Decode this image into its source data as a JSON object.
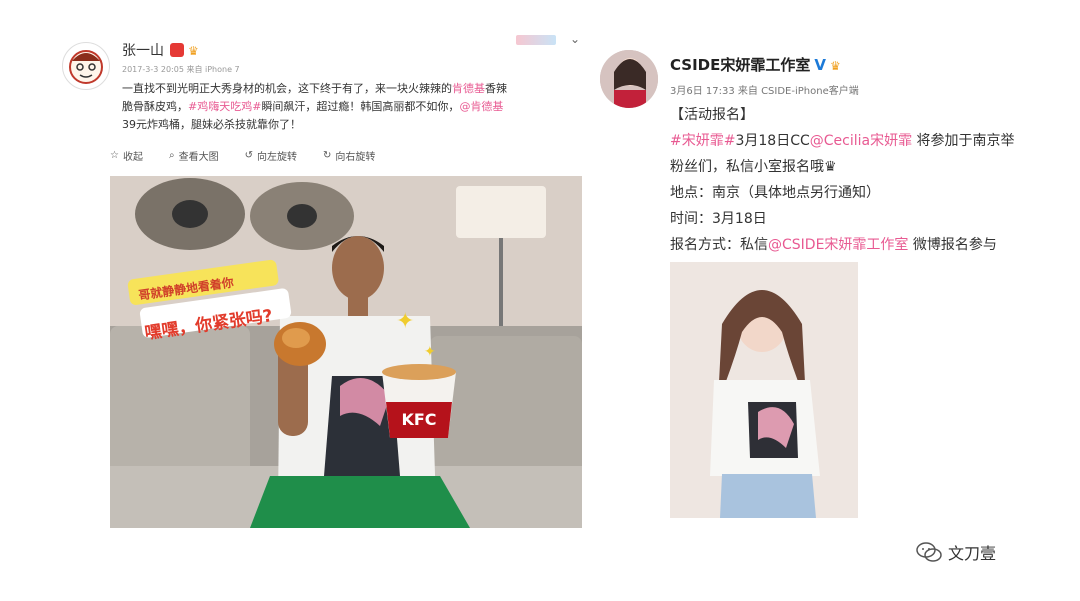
{
  "left_post": {
    "user_name": "张一山",
    "meta": "2017-3-3 20:05 来自 iPhone 7",
    "top_right_label": "⌄",
    "text_lines": [
      [
        "一直找不到光明正大秀身材的机会，这下终于有了，来一块火辣辣的",
        {
          "hl": "肯德基"
        },
        "香辣"
      ],
      [
        "脆骨酥皮鸡，",
        {
          "hl": "#鸡嗨天吃鸡#"
        },
        "瞬间飙汗，超过瘾！韩国高丽都不如你，",
        {
          "hl": "@肯德基"
        }
      ],
      [
        "39元炸鸡桶，腿妹必杀技就靠你了！"
      ]
    ],
    "toolbar": [
      {
        "icon": "star-icon",
        "label": "收起"
      },
      {
        "icon": "search-icon",
        "label": "查看大图"
      },
      {
        "icon": "rotate-left-icon",
        "label": "向左旋转"
      },
      {
        "icon": "rotate-right-icon",
        "label": "向右旋转"
      }
    ],
    "photo_caption_top": "哥就静静地看着你",
    "photo_caption_bottom": "嘿嘿，你紧张吗?",
    "bucket_text": "KFC"
  },
  "right_post": {
    "user_name": "CSIDE宋妍霏工作室",
    "verified": "V",
    "meta": "3月6日 17:33 来自 CSIDE-iPhone客户端",
    "lines": [
      [
        "【活动报名】"
      ],
      [
        {
          "hl": "#宋妍霏#"
        },
        "3月18日CC",
        {
          "hl": "@Cecilia宋妍霏"
        },
        " 将参加于南京举"
      ],
      [
        "粉丝们，私信小室报名哦♛"
      ],
      [
        "地点：南京（具体地点另行通知）"
      ],
      [
        "时间：3月18日"
      ],
      [
        "报名方式：私信",
        {
          "hl": "@CSIDE宋妍霏工作室"
        },
        " 微博报名参与"
      ]
    ]
  },
  "watermark": {
    "icon": "wechat-icon",
    "text": "文刀壹"
  },
  "colors": {
    "highlight": "#e85a92",
    "verified_blue": "#1c7ad8",
    "bucket_red": "#b5121b"
  }
}
